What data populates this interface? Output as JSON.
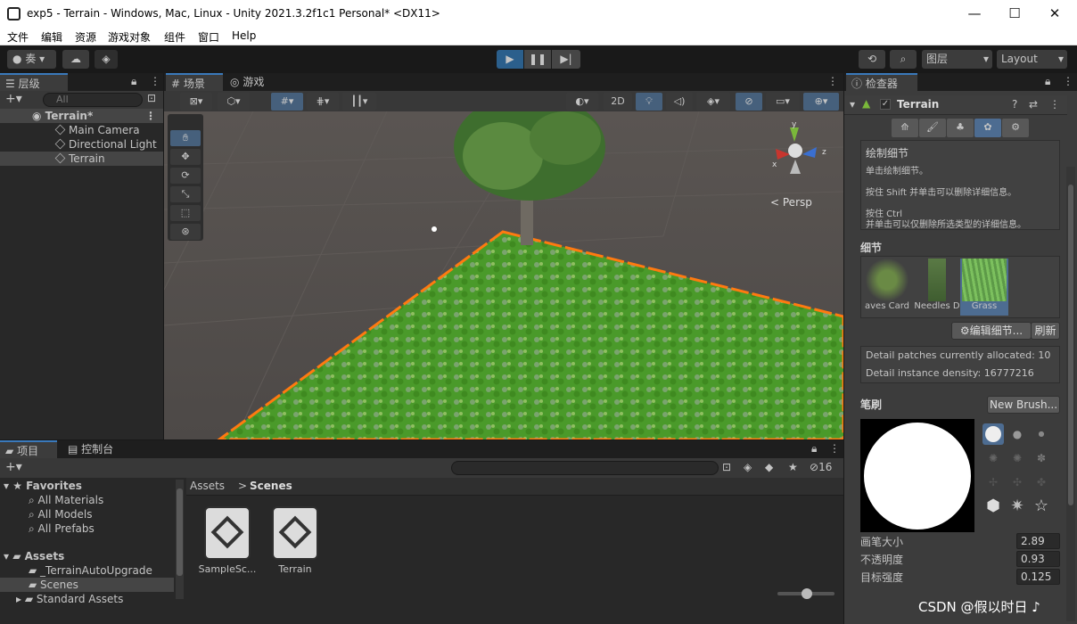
{
  "window": {
    "title": "exp5 - Terrain - Windows, Mac, Linux - Unity 2021.3.2f1c1 Personal* <DX11>",
    "controls": [
      "—",
      "☐",
      "✕"
    ]
  },
  "menubar": [
    "文件",
    "编辑",
    "资源",
    "游戏对象",
    "组件",
    "窗口",
    "Help"
  ],
  "toolbar": {
    "account": "奏",
    "layers_label": "图层",
    "layout_label": "Layout"
  },
  "hierarchy": {
    "tab": "层级",
    "search_placeholder": "All",
    "scene_name": "Terrain*",
    "items": [
      "Main Camera",
      "Directional Light",
      "Terrain"
    ]
  },
  "scene": {
    "tab_scene": "场景",
    "tab_game": "游戏",
    "mode_2d": "2D",
    "persp_label": "Persp",
    "axis_x": "x",
    "axis_y": "y",
    "axis_z": "z"
  },
  "inspector": {
    "tab": "检查器",
    "component": "Terrain",
    "paint_title": "绘制细节",
    "help_lines": [
      "单击绘制细节。",
      "按住 Shift 并单击可以删除详细信息。",
      "按住 Ctrl",
      "并单击可以仅删除所选类型的详细信息。"
    ],
    "details_header": "细节",
    "details": [
      "aves Card",
      "Needles D",
      "Grass"
    ],
    "edit_details_button": "编辑细节...",
    "refresh_button": "刷新",
    "info_lines": [
      "Detail patches currently allocated: 10",
      "Detail instance density: 16777216"
    ],
    "brushes_header": "笔刷",
    "new_brush_button": "New Brush...",
    "props": [
      {
        "label": "画笔大小",
        "value": "2.89"
      },
      {
        "label": "不透明度",
        "value": "0.93"
      },
      {
        "label": "目标强度",
        "value": "0.125"
      }
    ]
  },
  "project": {
    "tab_project": "项目",
    "tab_console": "控制台",
    "hidden_count": "16",
    "favorites_label": "Favorites",
    "favorites": [
      "All Materials",
      "All Models",
      "All Prefabs"
    ],
    "assets_label": "Assets",
    "asset_folders": [
      "_TerrainAutoUpgrade",
      "Scenes",
      "Standard Assets"
    ],
    "breadcrumb_root": "Assets",
    "breadcrumb_current": "Scenes",
    "files": [
      "SampleSc...",
      "Terrain"
    ]
  },
  "watermark": "CSDN @假以时日 ♪"
}
